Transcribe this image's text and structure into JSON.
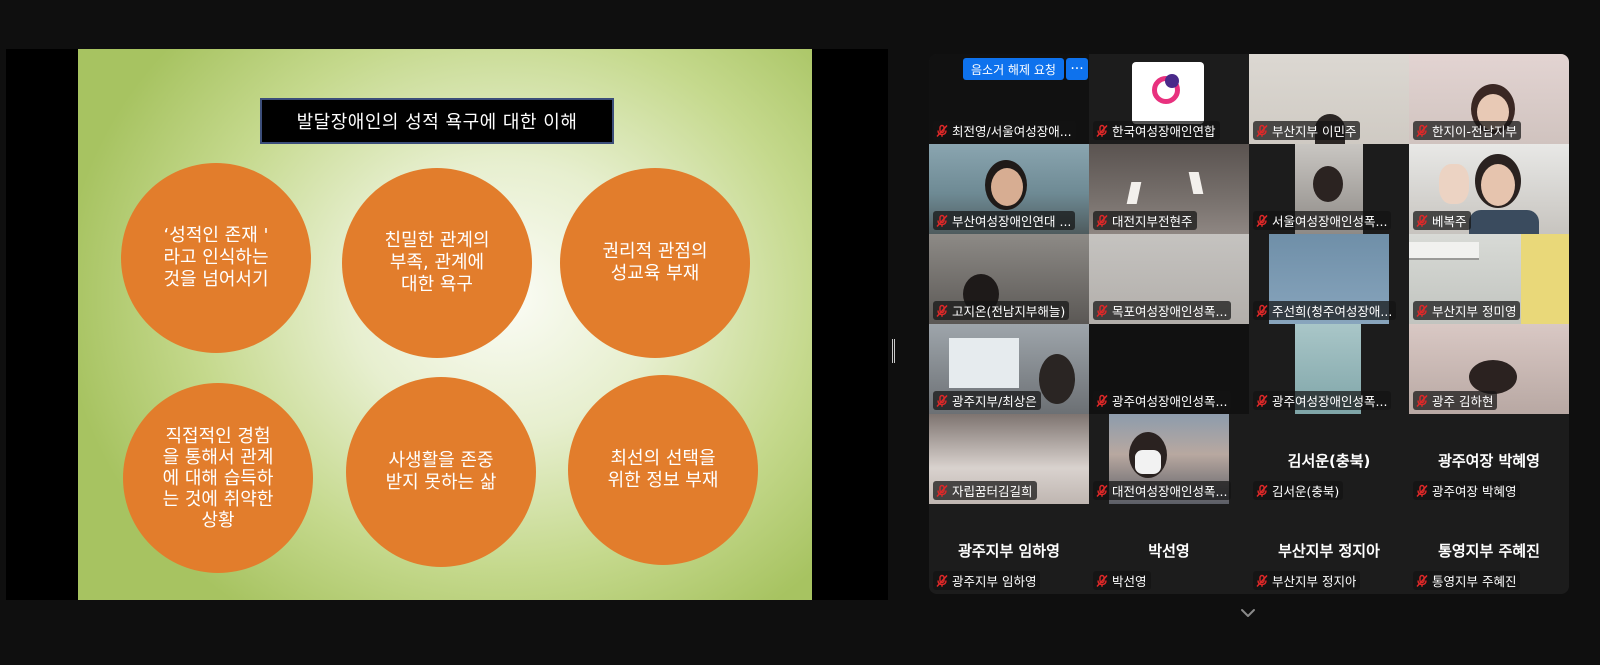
{
  "colors": {
    "slide_circle": "#e27d2c",
    "slide_title_bg": "#000000",
    "gallery_bg": "#1c1c1c",
    "active_speaker_border": "#23d959",
    "request_button": "#0e72ed",
    "muted_mic": "#e02828"
  },
  "slide": {
    "title": "발달장애인의 성적 욕구에 대한 이해",
    "circles": [
      "‘성적인 존재 '\n라고 인식하는\n것을 넘어서기",
      "친밀한 관계의\n부족, 관계에\n대한 욕구",
      "권리적 관점의\n성교육 부재",
      "직접적인 경험\n을 통해서 관계\n에 대해 습득하\n는 것에 취약한\n상황",
      "사생활을 존중\n받지 못하는 삶",
      "최선의 선택을\n위한 정보 부재"
    ]
  },
  "gallery": {
    "request_unmute_label": "음소거 해제 요청",
    "more_label": "···",
    "participants": [
      {
        "name": "최전영/서울여성장애..."
      },
      {
        "name": "한국여성장애인연합"
      },
      {
        "name": "부산지부 이민주"
      },
      {
        "name": "한지이-전남지부"
      },
      {
        "name": "부산여성장애인연대 ..."
      },
      {
        "name": "대전지부전현주"
      },
      {
        "name": "서울여성장애인성폭..."
      },
      {
        "name": "베복주"
      },
      {
        "name": "고지온(전남지부해늘)"
      },
      {
        "name": "목포여성장애인성폭..."
      },
      {
        "name": "주선희(청주여성장애..."
      },
      {
        "name": "부산지부 정미영"
      },
      {
        "name": "광주지부/최상은"
      },
      {
        "name": "광주여성장애인성폭..."
      },
      {
        "name": "광주여성장애인성폭..."
      },
      {
        "name": "광주 김하현"
      },
      {
        "name": "자립꿈터김길희"
      },
      {
        "name": "대전여성장애인성폭..."
      },
      {
        "name": "김서운(충북)",
        "display_name": "김서운(충북)"
      },
      {
        "name": "광주여장 박혜영",
        "display_name": "광주여장 박혜영"
      },
      {
        "name": "광주지부 임하영",
        "display_name": "광주지부 임하영"
      },
      {
        "name": "박선영",
        "display_name": "박선영"
      },
      {
        "name": "부산지부 정지아",
        "display_name": "부산지부 정지아"
      },
      {
        "name": "통영지부 주혜진",
        "display_name": "통영지부 주혜진"
      }
    ]
  }
}
